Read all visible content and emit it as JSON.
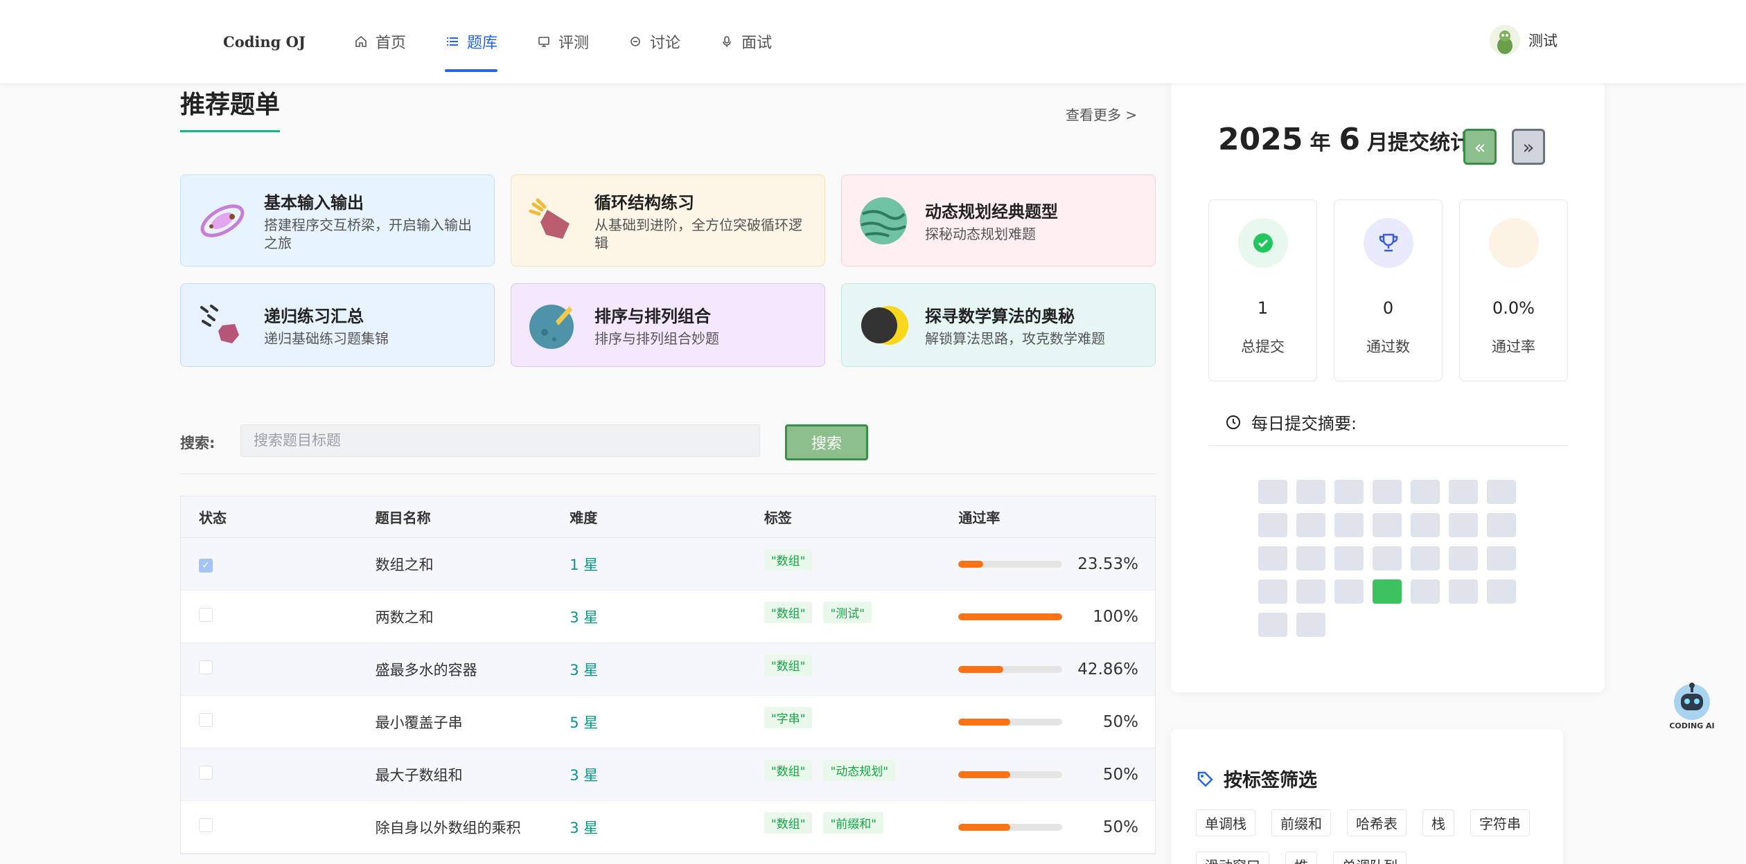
{
  "header": {
    "brand": "Coding OJ",
    "nav": [
      {
        "label": "首页",
        "icon": "home-icon"
      },
      {
        "label": "题库",
        "icon": "list-icon",
        "active": true
      },
      {
        "label": "评测",
        "icon": "monitor-icon"
      },
      {
        "label": "讨论",
        "icon": "discussion-icon"
      },
      {
        "label": "面试",
        "icon": "microphone-icon"
      }
    ],
    "user": {
      "name": "测试"
    }
  },
  "recommend": {
    "title": "推荐题单",
    "see_more": "查看更多 >",
    "cards": [
      {
        "title": "基本输入输出",
        "desc": "搭建程序交互桥梁，开启输入输出之旅",
        "icon": "galaxy-icon"
      },
      {
        "title": "循环结构练习",
        "desc": "从基础到进阶，全方位突破循环逻辑",
        "icon": "rocket-icon"
      },
      {
        "title": "动态规划经典题型",
        "desc": "探秘动态规划难题",
        "icon": "planet-icon"
      },
      {
        "title": "递归练习汇总",
        "desc": "递归基础练习题集锦",
        "icon": "asteroid-icon"
      },
      {
        "title": "排序与排列组合",
        "desc": "排序与排列组合妙题",
        "icon": "planet-rocket-icon"
      },
      {
        "title": "探寻数学算法的奥秘",
        "desc": "解锁算法思路，攻克数学难题",
        "icon": "eclipse-icon"
      }
    ]
  },
  "search": {
    "label": "搜索:",
    "placeholder": "搜索题目标题",
    "button": "搜索"
  },
  "table": {
    "headers": [
      "状态",
      "题目名称",
      "难度",
      "标签",
      "通过率"
    ],
    "rows": [
      {
        "checked": true,
        "name": "数组之和",
        "difficulty": "1 星",
        "tags": [
          "\"数组\""
        ],
        "rate": "23.53%",
        "rate_value": 0.2353
      },
      {
        "checked": false,
        "name": "两数之和",
        "difficulty": "3 星",
        "tags": [
          "\"数组\"",
          "\"测试\""
        ],
        "rate": "100%",
        "rate_value": 1.0
      },
      {
        "checked": false,
        "name": "盛最多水的容器",
        "difficulty": "3 星",
        "tags": [
          "\"数组\""
        ],
        "rate": "42.86%",
        "rate_value": 0.4286
      },
      {
        "checked": false,
        "name": "最小覆盖子串",
        "difficulty": "5 星",
        "tags": [
          "\"字串\""
        ],
        "rate": "50%",
        "rate_value": 0.5
      },
      {
        "checked": false,
        "name": "最大子数组和",
        "difficulty": "3 星",
        "tags": [
          "\"数组\"",
          "\"动态规划\""
        ],
        "rate": "50%",
        "rate_value": 0.5
      },
      {
        "checked": false,
        "name": "除自身以外数组的乘积",
        "difficulty": "3 星",
        "tags": [
          "\"数组\"",
          "\"前缀和\""
        ],
        "rate": "50%",
        "rate_value": 0.5
      }
    ]
  },
  "stats": {
    "year": "2025",
    "year_unit": "年",
    "month": "6",
    "month_suffix": "月提交统计",
    "prev_label": "«",
    "next_label": "»",
    "boxes": [
      {
        "value": "1",
        "label": "总提交",
        "icon": "check-circle-icon",
        "color": "#22c55e"
      },
      {
        "value": "0",
        "label": "通过数",
        "icon": "trophy-icon",
        "color": "#3b5bdb"
      },
      {
        "value": "0.0%",
        "label": "通过率",
        "icon": "rate-icon",
        "color": "#f5e6c8"
      }
    ],
    "daily_title": "每日提交摘要:",
    "days": 30,
    "active_day": 25
  },
  "tag_filter": {
    "title": "按标签筛选",
    "tags": [
      "单调栈",
      "前缀和",
      "哈希表",
      "栈",
      "字符串",
      "滑动窗口",
      "堆",
      "单调队列"
    ]
  },
  "ai": {
    "label": "CODING AI"
  }
}
